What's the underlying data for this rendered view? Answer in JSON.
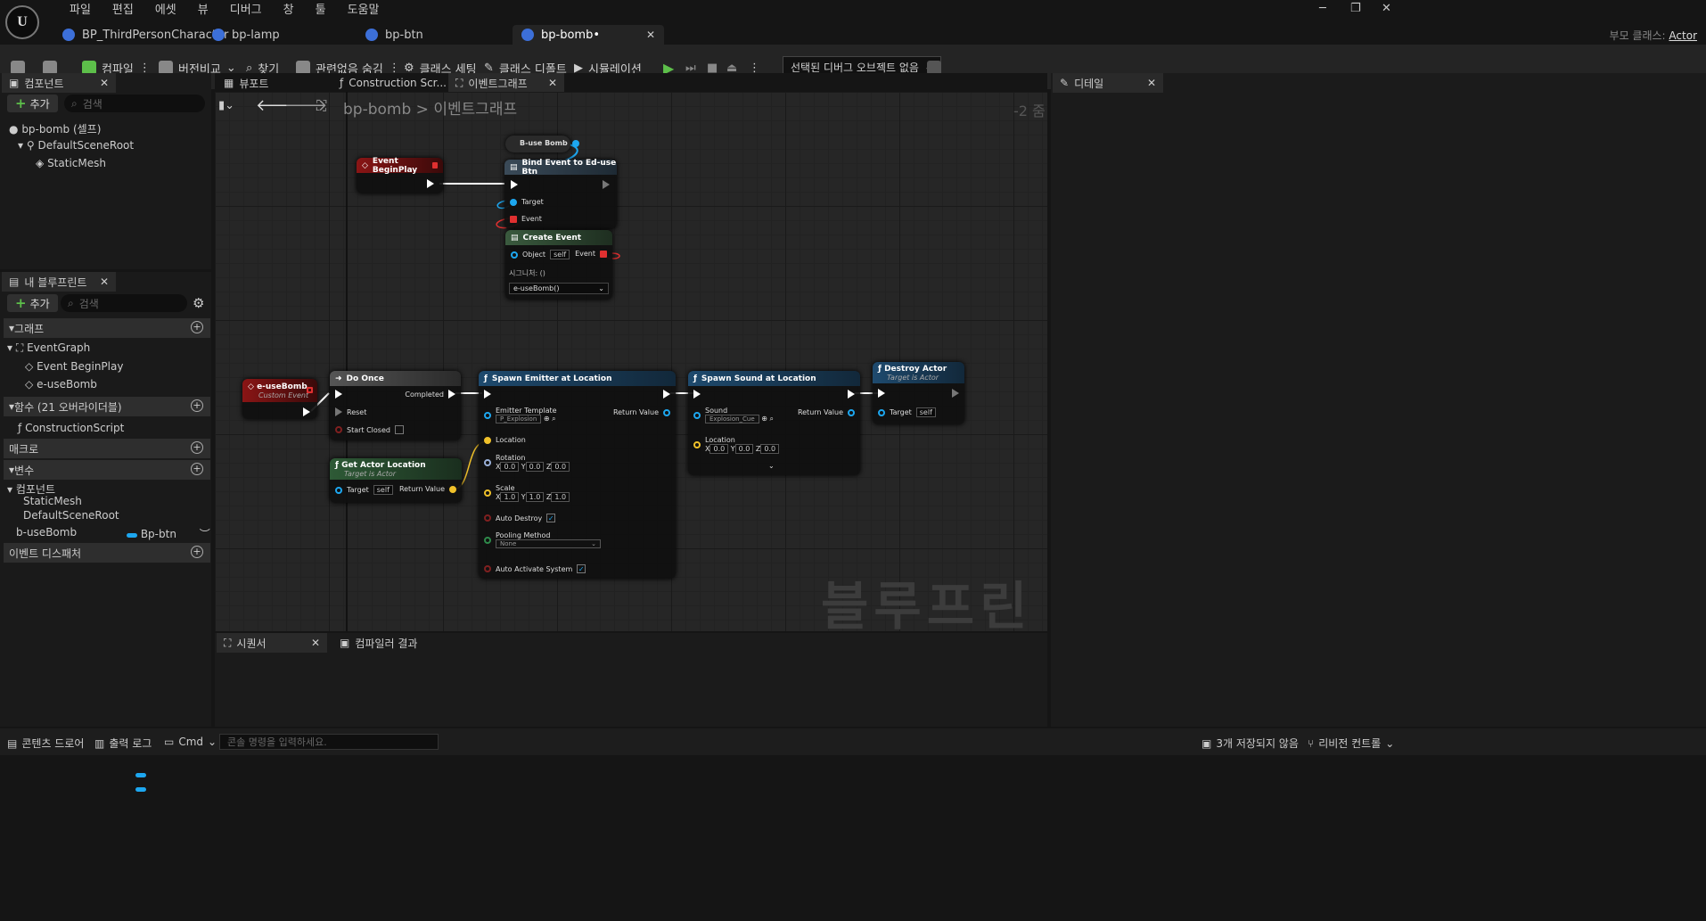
{
  "menu": [
    "파일",
    "편집",
    "에셋",
    "뷰",
    "디버그",
    "창",
    "툴",
    "도움말"
  ],
  "logo": "U",
  "tabs": [
    {
      "label": "BP_ThirdPersonCharacter"
    },
    {
      "label": "bp-lamp"
    },
    {
      "label": "bp-btn"
    },
    {
      "label": "bp-bomb•"
    }
  ],
  "window": {
    "minimize": "─",
    "restore": "❐",
    "close": "✕"
  },
  "parent_class": {
    "label": "부모 클래스:",
    "value": "Actor"
  },
  "toolbar": {
    "compile": "컴파일",
    "diff": "버전비교",
    "find": "찾기",
    "hide_unrelated": "관련없음 숨김",
    "class_settings": "클래스 세팅",
    "class_defaults": "클래스 디폴트",
    "simulation": "시뮬레이션",
    "debug_object": "선택된 디버그 오브젝트 없음"
  },
  "components_panel": {
    "title": "컴포넌트",
    "add": "추가",
    "search_placeholder": "검색",
    "items": [
      "bp-bomb (셀프)",
      "DefaultSceneRoot",
      "StaticMesh"
    ]
  },
  "my_blueprint": {
    "title": "내 블루프린트",
    "add": "추가",
    "search_placeholder": "검색",
    "graphs_label": "그래프",
    "event_graph": "EventGraph",
    "events": [
      "Event BeginPlay",
      "e-useBomb"
    ],
    "functions_label": "함수 (21 오버라이더블)",
    "construction": "ConstructionScript",
    "macros_label": "매크로",
    "variables_label": "변수",
    "components_label": "컴포넌트",
    "component_vars": [
      "StaticMesh",
      "DefaultSceneRoot"
    ],
    "var_name": "b-useBomb",
    "var_type": "Bp-btn",
    "dispatchers_label": "이벤트 디스패처"
  },
  "editor_tabs": [
    "뷰포트",
    "Construction Scr...",
    "이벤트그래프"
  ],
  "breadcrumb": {
    "root": "bp-bomb",
    "sep": ">",
    "current": "이벤트그래프",
    "zoom": "-2 줌"
  },
  "nodes": {
    "var_get": "B-use Bomb",
    "begin_play": "Event BeginPlay",
    "bind_event": {
      "title": "Bind Event to Ed-use Btn",
      "target": "Target",
      "event": "Event"
    },
    "create_event": {
      "title": "Create Event",
      "object": "Object",
      "self": "self",
      "event": "Event",
      "signature": "시그니처: ()",
      "func": "e-useBomb()"
    },
    "custom_event": {
      "title": "e-useBomb",
      "subtitle": "Custom Event"
    },
    "do_once": {
      "title": "Do Once",
      "completed": "Completed",
      "reset": "Reset",
      "start_closed": "Start Closed"
    },
    "get_actor_location": {
      "title": "Get Actor Location",
      "subtitle": "Target is Actor",
      "target": "Target",
      "self": "self",
      "ret": "Return Value"
    },
    "spawn_emitter": {
      "title": "Spawn Emitter at Location",
      "template": "Emitter Template",
      "template_val": "P_Explosion",
      "ret": "Return Value",
      "location": "Location",
      "rotation": "Rotation",
      "scale": "Scale",
      "rx": "0.0",
      "ry": "0.0",
      "rz": "0.0",
      "sx": "1.0",
      "sy": "1.0",
      "sz": "1.0",
      "auto_destroy": "Auto Destroy",
      "pooling": "Pooling Method",
      "pooling_val": "None",
      "auto_activate": "Auto Activate System"
    },
    "spawn_sound": {
      "title": "Spawn Sound at Location",
      "sound": "Sound",
      "sound_val": "Explosion_Cue",
      "ret": "Return Value",
      "location": "Location",
      "lx": "0.0",
      "ly": "0.0",
      "lz": "0.0"
    },
    "destroy_actor": {
      "title": "Destroy Actor",
      "subtitle": "Target is Actor",
      "target": "Target",
      "self": "self"
    }
  },
  "watermark": "블루프린트",
  "bottom_tabs": [
    "시퀀서",
    "컴파일러 결과"
  ],
  "details_title": "디테일",
  "status": {
    "content_drawer": "콘텐츠 드로어",
    "output_log": "출력 로그",
    "cmd": "Cmd",
    "console_placeholder": "콘솔 명령을 입력하세요.",
    "unsaved": "3개 저장되지 않음",
    "revision": "리비전 컨트롤"
  },
  "colors": {
    "accent": "#1da7f0",
    "event_header": "#8a1515",
    "func_header": "#1e4a6e",
    "pure_header": "#2e5a36",
    "green_play": "#5dbf4a"
  }
}
